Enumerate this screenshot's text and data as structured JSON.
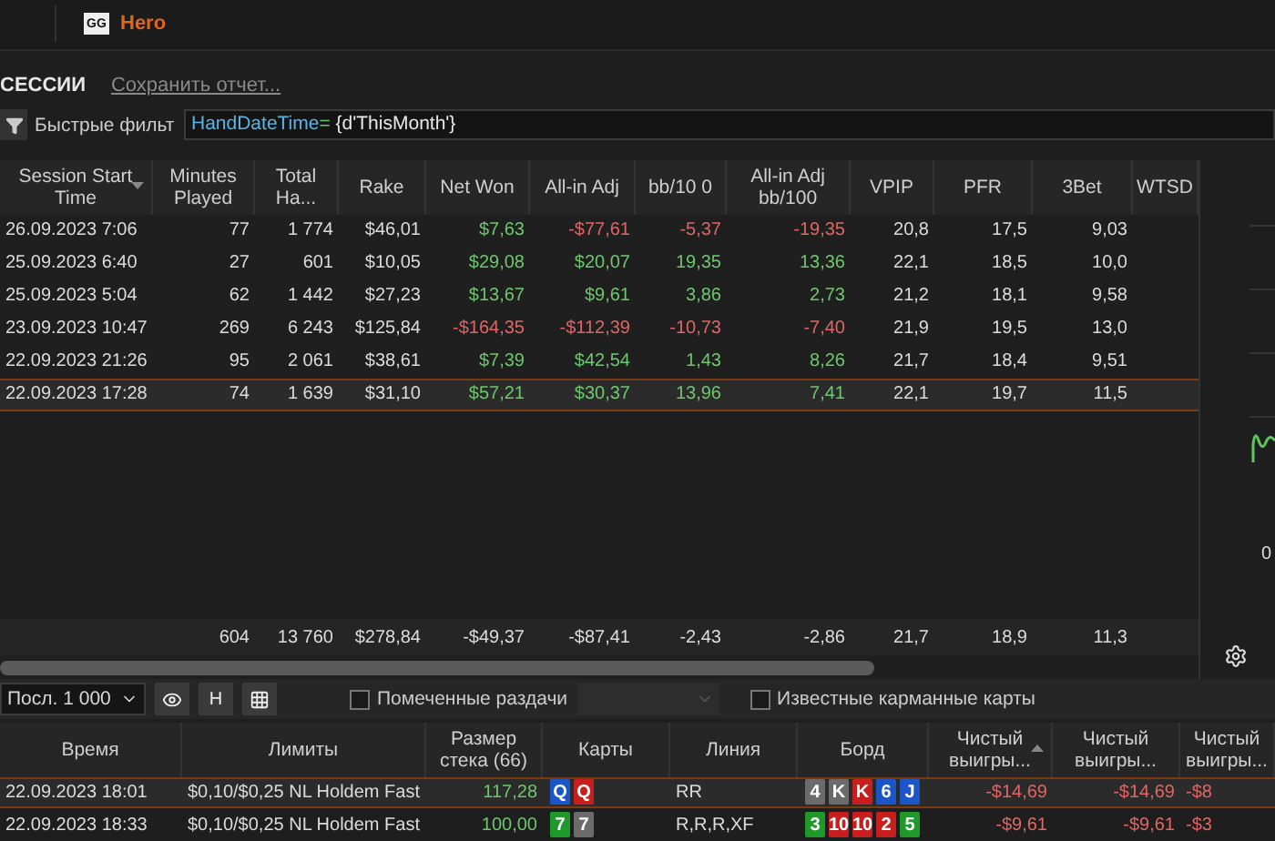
{
  "topbar": {
    "logo": "GG",
    "player": "Hero"
  },
  "section": {
    "title": "СЕССИИ",
    "save_link": "Сохранить отчет..."
  },
  "filter": {
    "label": "Быстрые фильт",
    "tokens": [
      {
        "text": "HandDateTime",
        "kind": "field"
      },
      {
        "text": "=",
        "kind": "operator"
      },
      {
        "text": " {d'ThisMonth'}",
        "kind": "value"
      }
    ]
  },
  "sessions": {
    "columns": [
      {
        "label": "Session Start Time",
        "sorted": true
      },
      {
        "label": "Minutes Played",
        "sorted": false
      },
      {
        "label": "Total Ha...",
        "sorted": false
      },
      {
        "label": "Rake",
        "sorted": false
      },
      {
        "label": "Net Won",
        "sorted": false
      },
      {
        "label": "All-in Adj",
        "sorted": false
      },
      {
        "label": "bb/10 0",
        "sorted": false
      },
      {
        "label": "All-in Adj bb/100",
        "sorted": false
      },
      {
        "label": "VPIP",
        "sorted": false
      },
      {
        "label": "PFR",
        "sorted": false
      },
      {
        "label": "3Bet",
        "sorted": false
      },
      {
        "label": "WTSD",
        "sorted": false
      }
    ],
    "rows": [
      {
        "selected": false,
        "cells": [
          "26.09.2023 7:06",
          "77",
          "1 774",
          "$46,01",
          {
            "text": "$7,63",
            "color": "#6cc86c"
          },
          {
            "text": "-$77,61",
            "color": "#e06666"
          },
          {
            "text": "-5,37",
            "color": "#e06666"
          },
          {
            "text": "-19,35",
            "color": "#e06666"
          },
          "20,8",
          "17,5",
          "9,03"
        ]
      },
      {
        "selected": false,
        "cells": [
          "25.09.2023 6:40",
          "27",
          "601",
          "$10,05",
          {
            "text": "$29,08",
            "color": "#6cc86c"
          },
          {
            "text": "$20,07",
            "color": "#6cc86c"
          },
          {
            "text": "19,35",
            "color": "#6cc86c"
          },
          {
            "text": "13,36",
            "color": "#6cc86c"
          },
          "22,1",
          "18,5",
          "10,0"
        ]
      },
      {
        "selected": false,
        "cells": [
          "25.09.2023 5:04",
          "62",
          "1 442",
          "$27,23",
          {
            "text": "$13,67",
            "color": "#6cc86c"
          },
          {
            "text": "$9,61",
            "color": "#6cc86c"
          },
          {
            "text": "3,86",
            "color": "#6cc86c"
          },
          {
            "text": "2,73",
            "color": "#6cc86c"
          },
          "21,2",
          "18,1",
          "9,58"
        ]
      },
      {
        "selected": false,
        "cells": [
          "23.09.2023 10:47",
          "269",
          "6 243",
          "$125,84",
          {
            "text": "-$164,35",
            "color": "#e06666"
          },
          {
            "text": "-$112,39",
            "color": "#e06666"
          },
          {
            "text": "-10,73",
            "color": "#e06666"
          },
          {
            "text": "-7,40",
            "color": "#e06666"
          },
          "21,9",
          "19,5",
          "13,0"
        ]
      },
      {
        "selected": false,
        "cells": [
          "22.09.2023 21:26",
          "95",
          "2 061",
          "$38,61",
          {
            "text": "$7,39",
            "color": "#6cc86c"
          },
          {
            "text": "$42,54",
            "color": "#6cc86c"
          },
          {
            "text": "1,43",
            "color": "#6cc86c"
          },
          {
            "text": "8,26",
            "color": "#6cc86c"
          },
          "21,7",
          "18,4",
          "9,51"
        ]
      },
      {
        "selected": true,
        "cells": [
          "22.09.2023 17:28",
          "74",
          "1 639",
          "$31,10",
          {
            "text": "$57,21",
            "color": "#6cc86c"
          },
          {
            "text": "$30,37",
            "color": "#6cc86c"
          },
          {
            "text": "13,96",
            "color": "#6cc86c"
          },
          {
            "text": "7,41",
            "color": "#6cc86c"
          },
          "22,1",
          "19,7",
          "11,5"
        ]
      }
    ],
    "totals": [
      "604",
      "13 760",
      "$278,84",
      "-$49,37",
      "-$87,41",
      "-2,43",
      "-2,86",
      "21,7",
      "18,9",
      "11,3"
    ]
  },
  "side_panel": {
    "axis_value": "0"
  },
  "controls": {
    "range": "Посл. 1 000",
    "hand_button": "H",
    "marked_hands": {
      "label": "Помеченные раздачи",
      "checked": false
    },
    "known_cards": {
      "label": "Известные карманные карты",
      "checked": false
    }
  },
  "hands": {
    "columns": [
      {
        "label": "Время",
        "sorted": false
      },
      {
        "label": "Лимиты",
        "sorted": false
      },
      {
        "label": "Размер стека (66)",
        "sorted": false
      },
      {
        "label": "Карты",
        "sorted": false
      },
      {
        "label": "Линия",
        "sorted": false
      },
      {
        "label": "Борд",
        "sorted": false
      },
      {
        "label": "Чистый выигры...",
        "sorted": true
      },
      {
        "label": "Чистый выигры...",
        "sorted": false
      },
      {
        "label": "Чистый выигры...",
        "sorted": false
      }
    ],
    "rows": [
      {
        "selected": true,
        "time": "22.09.2023 18:01",
        "limits": "$0,10/$0,25 NL Holdem Fast",
        "stack": "117,28",
        "cards": [
          {
            "rank": "Q",
            "color": "#1a56c8"
          },
          {
            "rank": "Q",
            "color": "#c81e1e"
          }
        ],
        "line": "RR",
        "board": [
          {
            "rank": "4",
            "color": "#6b6b6b"
          },
          {
            "rank": "K",
            "color": "#6b6b6b"
          },
          {
            "rank": "K",
            "color": "#c81e1e"
          },
          {
            "rank": "6",
            "color": "#1a56c8"
          },
          {
            "rank": "J",
            "color": "#1a56c8"
          }
        ],
        "net": [
          "-$14,69",
          "-$14,69",
          "-$8"
        ]
      },
      {
        "selected": false,
        "time": "22.09.2023 18:33",
        "limits": "$0,10/$0,25 NL Holdem Fast",
        "stack": "100,00",
        "cards": [
          {
            "rank": "7",
            "color": "#1f9a2a"
          },
          {
            "rank": "7",
            "color": "#6b6b6b"
          }
        ],
        "line": "R,R,R,XF",
        "board": [
          {
            "rank": "3",
            "color": "#1f9a2a"
          },
          {
            "rank": "10",
            "color": "#c81e1e"
          },
          {
            "rank": "10",
            "color": "#c81e1e"
          },
          {
            "rank": "2",
            "color": "#c81e1e"
          },
          {
            "rank": "5",
            "color": "#1f9a2a"
          }
        ],
        "net": [
          "-$9,61",
          "-$9,61",
          "-$3"
        ]
      }
    ]
  }
}
